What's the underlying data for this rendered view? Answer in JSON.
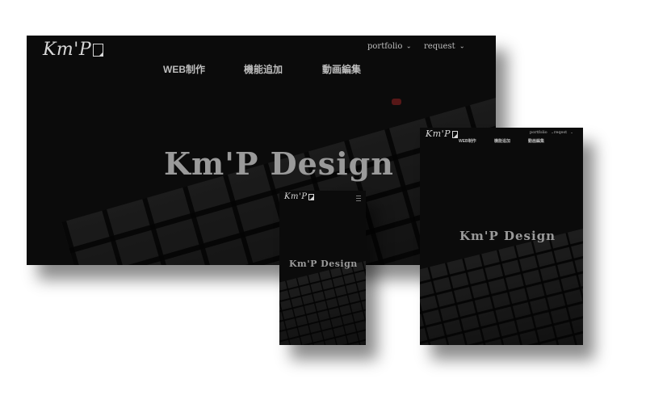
{
  "brand": {
    "logo_text": "Km'P"
  },
  "desktop": {
    "nav": [
      {
        "label": "portfolio",
        "chevron": "⌄"
      },
      {
        "label": "request",
        "chevron": "⌄"
      }
    ],
    "menu": [
      "WEB制作",
      "機能追加",
      "動画編集"
    ],
    "hero_title": "Km'P  Design"
  },
  "tablet": {
    "nav": [
      {
        "label": "portfolio",
        "chevron": "⌄"
      },
      {
        "label": "reqest",
        "chevron": "⌄"
      }
    ],
    "menu": [
      "WEB制作",
      "機能追加",
      "動画編集"
    ],
    "hero_title": "Km'P  Design"
  },
  "mobile": {
    "menu_icon": "hamburger-icon",
    "hero_title": "Km'P  Design"
  },
  "colors": {
    "background": "#0b0b0b",
    "text": "#bdbdbd",
    "accent_red": "#6a1a1a"
  }
}
